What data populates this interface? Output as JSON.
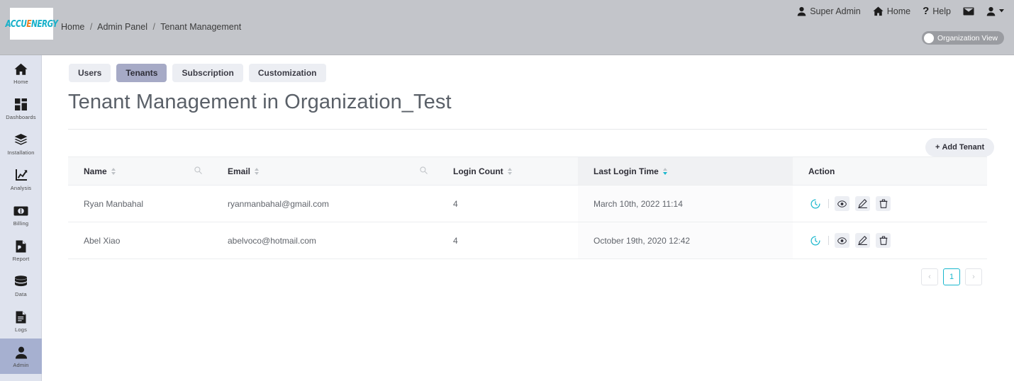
{
  "header": {
    "logo_text_left": "ACCU",
    "logo_text_accent": "E",
    "logo_text_right": "NERGY",
    "logo_name": "ACCUENERGY",
    "breadcrumb": [
      {
        "label": "Home"
      },
      {
        "label": "Admin Panel"
      },
      {
        "label": "Tenant Management"
      }
    ],
    "breadcrumb_separator": "/",
    "nav": [
      {
        "label": "Super Admin",
        "icon": "user-icon"
      },
      {
        "label": "Home",
        "icon": "home-icon"
      },
      {
        "label": "Help",
        "icon": "question-mark-icon"
      },
      {
        "label": "",
        "icon": "envelope-icon"
      },
      {
        "label": "",
        "icon": "user-dropdown-icon"
      }
    ],
    "org_view_toggle": {
      "label": "Organization View",
      "state": "off"
    }
  },
  "sidebar": {
    "items": [
      {
        "label": "Home",
        "icon": "home-icon",
        "active": false
      },
      {
        "label": "Dashboards",
        "icon": "dashboards-icon",
        "active": false
      },
      {
        "label": "Installation",
        "icon": "layers-icon",
        "active": false
      },
      {
        "label": "Analysis",
        "icon": "chart-icon",
        "active": false
      },
      {
        "label": "Billing",
        "icon": "money-icon",
        "active": false
      },
      {
        "label": "Report",
        "icon": "pdf-icon",
        "active": false
      },
      {
        "label": "Data",
        "icon": "database-icon",
        "active": false
      },
      {
        "label": "Logs",
        "icon": "document-icon",
        "active": false
      },
      {
        "label": "Admin",
        "icon": "person-icon",
        "active": true
      }
    ]
  },
  "main": {
    "tabs": [
      {
        "label": "Users",
        "active": false
      },
      {
        "label": "Tenants",
        "active": true
      },
      {
        "label": "Subscription",
        "active": false
      },
      {
        "label": "Customization",
        "active": false
      }
    ],
    "page_title": "Tenant Management in Organization_Test",
    "add_tenant_button": "+ Add Tenant",
    "add_tenant_plus": "+",
    "add_tenant_label": "Add Tenant",
    "table": {
      "columns": [
        {
          "label": "Name",
          "sortable": true,
          "searchable": true,
          "sorted": false
        },
        {
          "label": "Email",
          "sortable": true,
          "searchable": true,
          "sorted": false
        },
        {
          "label": "Login Count",
          "sortable": true,
          "searchable": false,
          "sorted": false
        },
        {
          "label": "Last Login Time",
          "sortable": true,
          "searchable": false,
          "sorted": true
        },
        {
          "label": "Action",
          "sortable": false,
          "searchable": false,
          "sorted": false
        }
      ],
      "rows": [
        {
          "name": "Ryan Manbahal",
          "email": "ryanmanbahal@gmail.com",
          "login_count": "4",
          "last_login_time": "March 10th, 2022 11:14"
        },
        {
          "name": "Abel Xiao",
          "email": "abelvoco@hotmail.com",
          "login_count": "4",
          "last_login_time": "October 19th, 2020 12:42"
        }
      ],
      "row_actions": [
        {
          "name": "history-icon",
          "title": "History"
        },
        {
          "name": "view-icon",
          "title": "View"
        },
        {
          "name": "edit-icon",
          "title": "Edit"
        },
        {
          "name": "delete-icon",
          "title": "Delete"
        }
      ]
    },
    "pagination": {
      "prev": "‹",
      "next": "›",
      "pages": [
        "1"
      ],
      "current": "1"
    }
  },
  "colors": {
    "accent": "#19b7cd",
    "header_bg": "#c3c5ca",
    "sidebar_bg": "#dfe3ee",
    "sidebar_active": "#a6b0d0",
    "tab_active": "#a6aac6",
    "logo_cyan": "#16b0c9",
    "logo_orange": "#f07c1f"
  }
}
